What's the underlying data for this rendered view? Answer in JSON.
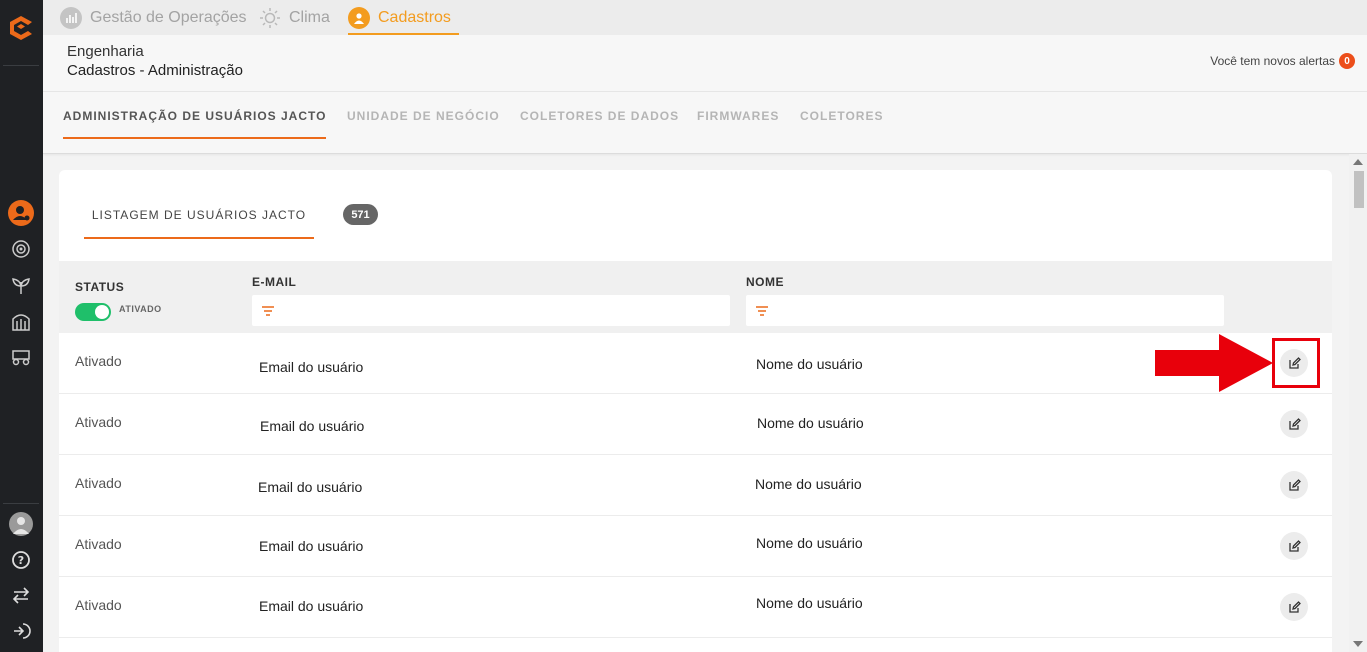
{
  "top_tabs": [
    {
      "label": "Gestão de Operações",
      "icon": "chart-icon"
    },
    {
      "label": "Clima",
      "icon": "sun-icon"
    },
    {
      "label": "Cadastros",
      "icon": "user-icon",
      "active": true
    }
  ],
  "header": {
    "breadcrumb_parent": "Engenharia",
    "breadcrumb_current": "Cadastros - Administração",
    "alerts_label": "Você tem novos alertas",
    "alerts_count": "0"
  },
  "section_tabs": [
    {
      "label": "ADMINISTRAÇÃO DE USUÁRIOS JACTO",
      "active": true
    },
    {
      "label": "UNIDADE DE NEGÓCIO"
    },
    {
      "label": "COLETORES DE DADOS"
    },
    {
      "label": "FIRMWARES"
    },
    {
      "label": "COLETORES"
    }
  ],
  "listing": {
    "tab_label": "LISTAGEM DE USUÁRIOS JACTO",
    "count": "571",
    "columns": {
      "status": "STATUS",
      "email": "E-MAIL",
      "name": "NOME"
    },
    "status_filter_label": "ATIVADO",
    "rows": [
      {
        "status": "Ativado",
        "email": "Email do usuário",
        "name": "Nome do usuário"
      },
      {
        "status": "Ativado",
        "email": "Email do usuário",
        "name": "Nome do usuário"
      },
      {
        "status": "Ativado",
        "email": "Email do usuário",
        "name": "Nome do usuário"
      },
      {
        "status": "Ativado",
        "email": "Email do usuário",
        "name": "Nome do usuário"
      },
      {
        "status": "Ativado",
        "email": "Email do usuário",
        "name": "Nome do usuário"
      }
    ]
  },
  "colors": {
    "accent": "#ec6a1a",
    "top_active": "#f39c1f",
    "toggle_on": "#1fbf6a",
    "annotation": "#e8000b"
  }
}
